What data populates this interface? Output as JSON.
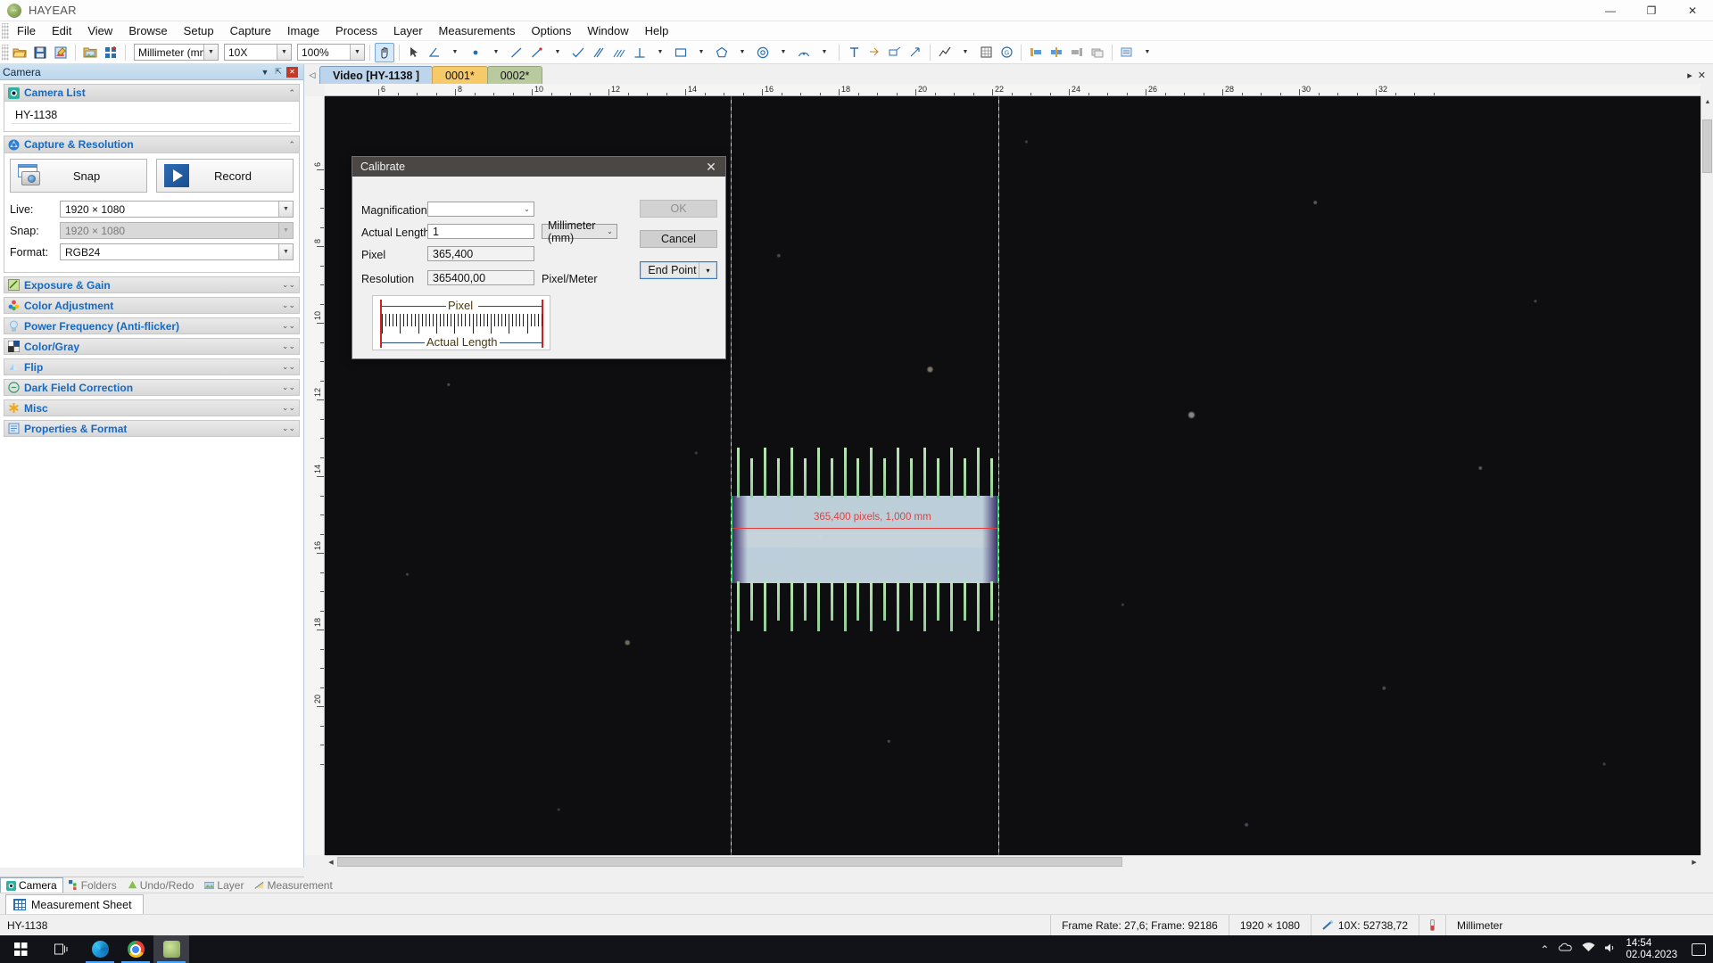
{
  "window": {
    "app_title": "HAYEAR",
    "minimize": "—",
    "maximize": "❐",
    "close": "✕"
  },
  "menubar": {
    "items": [
      "File",
      "Edit",
      "View",
      "Browse",
      "Setup",
      "Capture",
      "Image",
      "Process",
      "Layer",
      "Measurements",
      "Options",
      "Window",
      "Help"
    ]
  },
  "toolbar": {
    "unit_value": "Millimeter (mm)",
    "mag_value": "10X",
    "zoom_value": "100%",
    "icons": [
      "open-folder-icon",
      "save-icon",
      "export-icon",
      "image-folder-icon",
      "grid-add-icon",
      "pan-hand-icon",
      "arrow-select-icon",
      "angle-icon",
      "point-icon",
      "line-icon",
      "polyline-icon",
      "curve-icon",
      "rectangle-icon",
      "polygon-icon",
      "circle-icon",
      "ellipse-icon",
      "annulus-icon",
      "arc-icon",
      "text-icon",
      "dimension-icon",
      "arrow-annotation-icon",
      "chart-icon",
      "grid-overlay-icon",
      "counter-icon",
      "align-left-icon",
      "align-center-icon",
      "align-right-icon",
      "layers-icon",
      "settings-icon"
    ]
  },
  "left_panel": {
    "caption": "Camera",
    "caption_buttons": [
      "chevron-down-icon",
      "pin-icon",
      "close-icon"
    ],
    "groups": [
      {
        "title": "Camera List",
        "icon": "camera-icon",
        "expanded": true,
        "items": [
          "HY-1138"
        ]
      },
      {
        "title": "Capture & Resolution",
        "icon": "aperture-icon",
        "expanded": true
      }
    ],
    "capture": {
      "snap_label": "Snap",
      "record_label": "Record",
      "fields": [
        {
          "label": "Live:",
          "value": "1920 × 1080",
          "disabled": false
        },
        {
          "label": "Snap:",
          "value": "1920 × 1080",
          "disabled": true
        },
        {
          "label": "Format:",
          "value": "RGB24",
          "disabled": false
        }
      ]
    },
    "collapsed_groups": [
      {
        "title": "Exposure & Gain",
        "icon": "exposure-icon"
      },
      {
        "title": "Color Adjustment",
        "icon": "color-wheel-icon"
      },
      {
        "title": "Power Frequency (Anti-flicker)",
        "icon": "bulb-icon"
      },
      {
        "title": "Color/Gray",
        "icon": "color-gray-icon"
      },
      {
        "title": "Flip",
        "icon": "flip-icon"
      },
      {
        "title": "Dark Field Correction",
        "icon": "minus-circle-icon"
      },
      {
        "title": "Misc",
        "icon": "asterisk-icon"
      },
      {
        "title": "Properties & Format",
        "icon": "properties-icon"
      }
    ],
    "bottom_tabs": [
      {
        "label": "Camera",
        "icon": "camera-icon",
        "active": true
      },
      {
        "label": "Folders",
        "icon": "folders-icon",
        "active": false
      },
      {
        "label": "Undo/Redo",
        "icon": "undo-redo-icon",
        "active": false
      },
      {
        "label": "Layer",
        "icon": "layer-icon",
        "active": false
      },
      {
        "label": "Measurement",
        "icon": "measurement-icon",
        "active": false
      }
    ]
  },
  "measurement_sheet": {
    "label": "Measurement Sheet",
    "icon": "grid-icon"
  },
  "image_area": {
    "tabs": [
      {
        "label": "Video [HY-1138 ]",
        "state": "selected"
      },
      {
        "label": "0001*",
        "state": "modified-amber"
      },
      {
        "label": "0002*",
        "state": "modified-green"
      }
    ],
    "nav_left_icon": "chevron-left-icon",
    "nav_right_icon": "chevron-right-icon",
    "nav_close_icon": "close-icon",
    "ruler_h_labels": [
      "6",
      "8",
      "10",
      "12",
      "14",
      "16",
      "18",
      "20",
      "22",
      "24",
      "26",
      "28",
      "30",
      "32"
    ],
    "ruler_v_labels": [
      "6",
      "8",
      "10",
      "12",
      "14",
      "16",
      "18",
      "20"
    ],
    "annotation": "365,400 pixels, 1,000 mm"
  },
  "dialog": {
    "title": "Calibrate",
    "close_icon": "close-icon",
    "fields": {
      "magnification_label": "Magnification",
      "magnification_value": "",
      "actual_length_label": "Actual Length",
      "actual_length_value": "1",
      "actual_length_unit": "Millimeter (mm)",
      "pixel_label": "Pixel",
      "pixel_value": "365,400",
      "resolution_label": "Resolution",
      "resolution_value": "365400,00",
      "resolution_unit": "Pixel/Meter"
    },
    "buttons": {
      "ok": "OK",
      "ok_disabled": true,
      "cancel": "Cancel",
      "endpoint": "End Point",
      "endpoint_arrow": "▾"
    },
    "diagram": {
      "top_caption": "Pixel",
      "bottom_caption": "Actual Length"
    }
  },
  "statusbar": {
    "camera": "HY-1138",
    "frame": "Frame Rate: 27,6; Frame: 92186",
    "resolution": "1920 × 1080",
    "scale": "10X: 52738,72",
    "scale_icon": "ruler-pen-icon",
    "temp_icon": "thermometer-icon",
    "unit": "Millimeter"
  },
  "taskbar": {
    "start_icon": "windows-logo-icon",
    "taskview_icon": "task-view-icon",
    "apps": [
      "edge-icon",
      "chrome-icon",
      "hayear-icon"
    ],
    "tray": {
      "chevron": "⌃",
      "network_icon": "network-icon",
      "volume_icon": "volume-icon",
      "time": "14:54",
      "date": "02.04.2023",
      "notif_icon": "notification-icon"
    }
  },
  "colors": {
    "accent_blue": "#1769c0",
    "tab_selected": "#bcd5ec",
    "tab_amber": "#f6c969",
    "tab_green": "#b9cb9e",
    "annotation_red": "#e04040",
    "dialog_title": "#4a4744"
  }
}
